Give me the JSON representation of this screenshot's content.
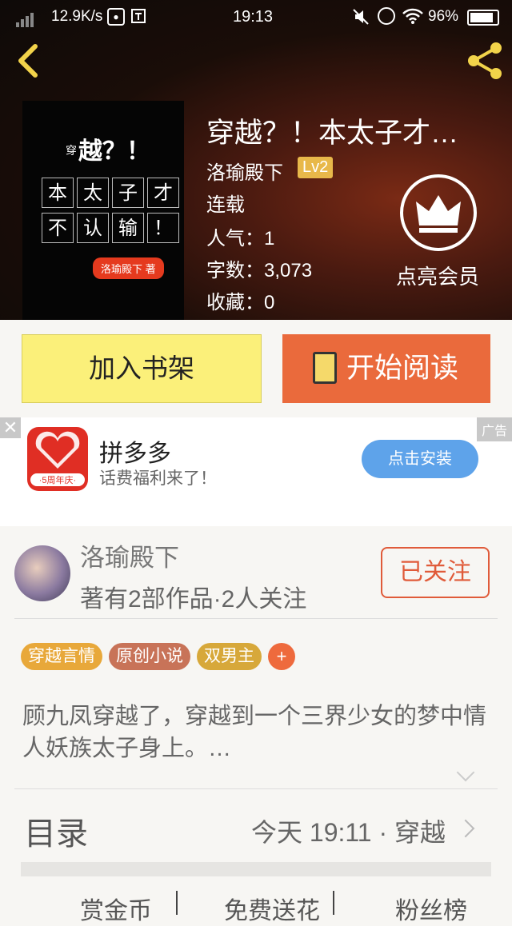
{
  "status_bar": {
    "speed": "12.9K/s",
    "time": "19:13",
    "battery": "96%"
  },
  "book": {
    "title": "穿越？！本太子才…",
    "author": "洛瑜殿下",
    "level": "Lv2",
    "state": "连载",
    "popularity": "人气：1",
    "words": "字数：3,073",
    "favorites": "收藏：0",
    "member_label": "点亮会员",
    "cover": {
      "title_top": "越？！",
      "title_top_small": "穿",
      "row1": [
        "本",
        "太",
        "子",
        "才"
      ],
      "row2": [
        "不",
        "认",
        "输",
        "！"
      ],
      "author_badge": "洛瑜殿下  著"
    }
  },
  "actions": {
    "shelf": "加入书架",
    "read": "开始阅读"
  },
  "ad": {
    "close": "✕",
    "tag": "广告",
    "app_name": "拼多多",
    "app_sub": "话费福利来了！",
    "logo_text": "·5周年庆·",
    "install": "点击安装"
  },
  "author_card": {
    "name": "洛瑜殿下",
    "info": "著有2部作品·2人关注",
    "follow": "已关注",
    "tags": [
      {
        "label": "穿越言情",
        "color": "#e8a83a"
      },
      {
        "label": "原创小说",
        "color": "#c87358"
      },
      {
        "label": "双男主",
        "color": "#d7a83a"
      }
    ],
    "plus": "+",
    "description": "顾九凤穿越了，穿越到一个三界少女的梦中情人妖族太子身上。…",
    "toc_label": "目录",
    "toc_latest": "今天 19:11 · 穿越",
    "bottom_tabs": [
      "赏金币",
      "免费送花",
      "粉丝榜"
    ]
  },
  "colors": {
    "shelf_bg": "#fbf07a",
    "read_bg": "#ea6a3c",
    "follow": "#e05b3a",
    "install": "#5ea3ea"
  }
}
